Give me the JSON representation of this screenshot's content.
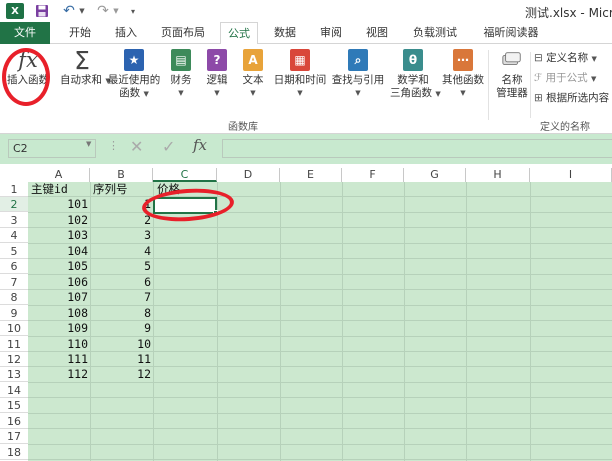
{
  "quick_access": {
    "logo": "X",
    "icons": [
      "excel-logo-icon",
      "save-icon",
      "undo-icon",
      "redo-icon",
      "customize-qat-icon"
    ]
  },
  "window": {
    "title": "测试.xlsx - Micro"
  },
  "tabs": {
    "file": "文件",
    "home": "开始",
    "insert": "插入",
    "page_layout": "页面布局",
    "formulas": "公式",
    "data": "数据",
    "review": "审阅",
    "view": "视图",
    "load_test": "负载测试",
    "foxit": "福昕阅读器"
  },
  "ribbon": {
    "function_library": {
      "insert_function_icon": "fx",
      "insert_function": "插入函数",
      "autosum_icon": "Σ",
      "autosum": "自动求和",
      "recent_1": "最近使用的",
      "recent_2": "函数",
      "finance": "财务",
      "logic": "逻辑",
      "text": "文本",
      "datetime": "日期和时间",
      "lookup": "查找与引用",
      "mathtrig_1": "数学和",
      "mathtrig_2": "三角函数",
      "more": "其他函数",
      "group_label": "函数库"
    },
    "defined_names": {
      "name_manager_1": "名称",
      "name_manager_2": "管理器",
      "define_name": "定义名称",
      "use_in_formula": "用于公式",
      "create_from_selection": "根据所选内容",
      "group_label": "定义的名称"
    },
    "colors": {
      "accent": "#217346",
      "annotation": "#e8202a",
      "grid_green": "#cce8cf"
    }
  },
  "formula_bar": {
    "name_box": "C2",
    "cancel_icon": "✕",
    "enter_icon": "✓",
    "fx_label": "fx",
    "formula": ""
  },
  "sheet": {
    "columns": [
      "A",
      "B",
      "C",
      "D",
      "E",
      "F",
      "G",
      "H",
      "I"
    ],
    "rows": [
      "1",
      "2",
      "3",
      "4",
      "5",
      "6",
      "7",
      "8",
      "9",
      "10",
      "11",
      "12",
      "13",
      "14",
      "15",
      "16",
      "17",
      "18"
    ],
    "selected_cell": "C2",
    "headers": {
      "a1": "主键id",
      "b1": "序列号",
      "c1": "价格"
    },
    "data": [
      {
        "a": "101",
        "b": "1"
      },
      {
        "a": "102",
        "b": "2"
      },
      {
        "a": "103",
        "b": "3"
      },
      {
        "a": "104",
        "b": "4"
      },
      {
        "a": "105",
        "b": "5"
      },
      {
        "a": "106",
        "b": "6"
      },
      {
        "a": "107",
        "b": "7"
      },
      {
        "a": "108",
        "b": "8"
      },
      {
        "a": "109",
        "b": "9"
      },
      {
        "a": "110",
        "b": "10"
      },
      {
        "a": "111",
        "b": "11"
      },
      {
        "a": "112",
        "b": "12"
      }
    ]
  }
}
